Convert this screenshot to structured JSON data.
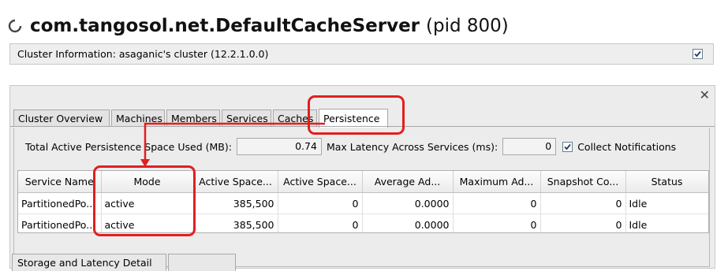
{
  "window": {
    "title": "com.tangosol.net.DefaultCacheServer",
    "pid": "(pid 800)",
    "status_icon": "spinner-icon"
  },
  "cluster_bar": {
    "label": "Cluster Information: asaganic's cluster (12.2.1.0.0)",
    "checked": true
  },
  "panel": {
    "close_label": "✕"
  },
  "tabs": [
    {
      "label": "Cluster Overview"
    },
    {
      "label": "Machines"
    },
    {
      "label": "Members"
    },
    {
      "label": "Services"
    },
    {
      "label": "Caches"
    },
    {
      "label": "Persistence",
      "active": true
    }
  ],
  "metrics": {
    "total_space_label": "Total Active Persistence Space Used (MB):",
    "total_space_value": "0.74",
    "max_latency_label": "Max Latency Across Services (ms):",
    "max_latency_value": "0",
    "collect_notifications_label": "Collect Notifications",
    "collect_notifications_checked": true
  },
  "table": {
    "columns": [
      "Service Name",
      "Mode",
      "Active Space...",
      "Active Space...",
      "Average Ad...",
      "Maximum Ad...",
      "Snapshot Co...",
      "Status"
    ],
    "rows": [
      [
        "PartitionedPo...",
        "active",
        "385,500",
        "0",
        "0.0000",
        "0",
        "0",
        "Idle"
      ],
      [
        "PartitionedPo...",
        "active",
        "385,500",
        "0",
        "0.0000",
        "0",
        "0",
        "Idle"
      ]
    ]
  },
  "bottom_tabs": [
    {
      "label": "Storage and Latency Detail"
    },
    {
      "label": ""
    }
  ],
  "annotation": {
    "highlight_color": "#e0201f"
  }
}
